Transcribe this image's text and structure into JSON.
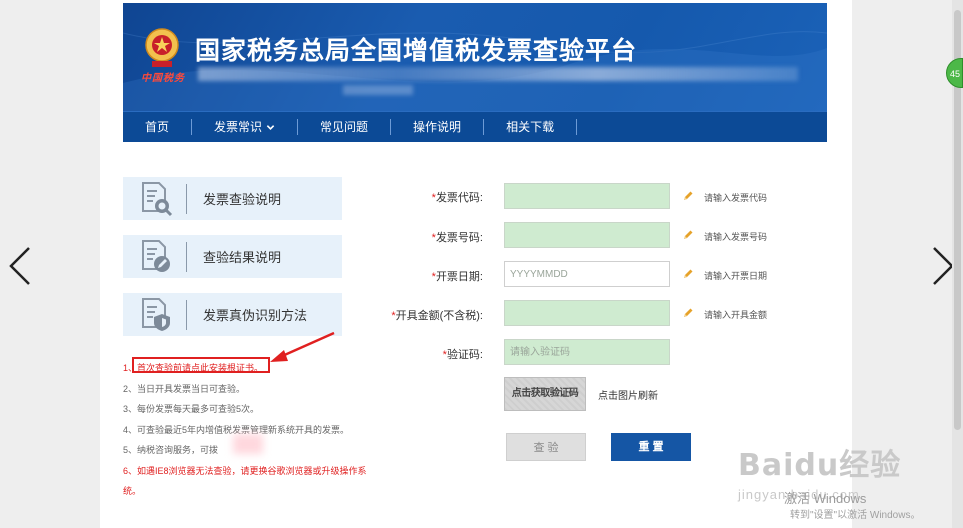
{
  "header": {
    "site_title": "国家税务总局全国增值税发票查验平台",
    "emblem_text": "中国税务"
  },
  "menu": {
    "items": [
      {
        "label": "首页"
      },
      {
        "label": "发票常识"
      },
      {
        "label": "常见问题"
      },
      {
        "label": "操作说明"
      },
      {
        "label": "相关下载"
      }
    ]
  },
  "cards": [
    {
      "label": "发票查验说明",
      "icon": "doc-search-icon"
    },
    {
      "label": "查验结果说明",
      "icon": "doc-edit-icon"
    },
    {
      "label": "发票真伪识别方法",
      "icon": "doc-shield-icon"
    }
  ],
  "notes": [
    {
      "text": "1、首次查验前请点此安装根证书。",
      "color": "red"
    },
    {
      "text": "2、当日开具发票当日可查验。",
      "color": "gray"
    },
    {
      "text": "3、每份发票每天最多可查验5次。",
      "color": "gray"
    },
    {
      "text": "4、可查验最近5年内增值税发票管理新系统开具的发票。",
      "color": "gray"
    },
    {
      "text": "5、纳税咨询服务，可拨",
      "color": "gray"
    },
    {
      "text": "6、如遇IE8浏览器无法查验，请更换谷歌浏览器或升级操作系统。",
      "color": "red"
    }
  ],
  "form": {
    "fields": [
      {
        "label": "发票代码:",
        "value": "",
        "placeholder": "",
        "hint": "请输入发票代码",
        "style": "green"
      },
      {
        "label": "发票号码:",
        "value": "",
        "placeholder": "",
        "hint": "请输入发票号码",
        "style": "green"
      },
      {
        "label": "开票日期:",
        "value": "",
        "placeholder": "YYYYMMDD",
        "hint": "请输入开票日期",
        "style": "white"
      },
      {
        "label": "开具金额(不含税):",
        "value": "",
        "placeholder": "",
        "hint": "请输入开具金额",
        "style": "green"
      },
      {
        "label": "验证码:",
        "value": "",
        "placeholder": "请输入验证码",
        "hint": "",
        "style": "green"
      }
    ],
    "required_mark": "*",
    "captcha_label": "点击获取验证码",
    "captcha_refresh": "点击图片刷新",
    "query_button": "查 验",
    "reset_button": "重 置"
  },
  "side_badge": "45",
  "watermark": {
    "baidu": "Baidu经验",
    "jingyan": "jingyan.baidu.com"
  },
  "windows": {
    "activate_title": "激活 Windows",
    "activate_hint": "转到\"设置\"以激活 Windows。"
  },
  "colors": {
    "header_blue": "#14519f",
    "menu_blue": "#0c4a96",
    "card_bg": "#e7f1fa",
    "field_green": "#cfebd0",
    "reset_blue": "#1556a5",
    "required_red": "#e02020"
  }
}
